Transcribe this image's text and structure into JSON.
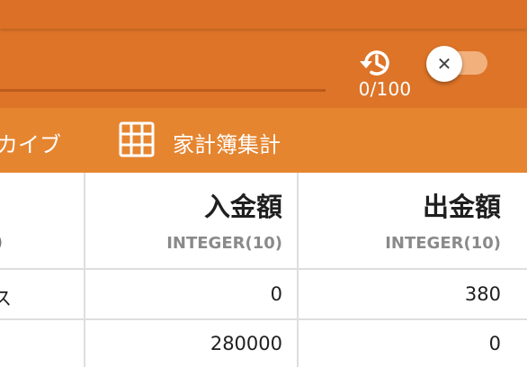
{
  "toolbar": {
    "history_icon": "history-icon",
    "history_count": "0/100",
    "toggle_icon": "close-icon",
    "toggle_symbol": "✕",
    "toggle_state": "off"
  },
  "tabs": [
    {
      "label": "カイブ",
      "icon": null
    },
    {
      "label": "家計簿集計",
      "icon": "grid-icon"
    }
  ],
  "table": {
    "columns": [
      {
        "title": "入金額",
        "type": "INTEGER(10)"
      },
      {
        "title": "出金額",
        "type": "INTEGER(10)"
      }
    ],
    "left_fragments": {
      "header_type": ")",
      "row1": "ス"
    },
    "rows": [
      [
        "0",
        "380"
      ],
      [
        "280000",
        "0"
      ]
    ]
  },
  "colors": {
    "app_bar": "#dd7428",
    "tab_bar": "#e58530",
    "grid_line": "#dedede"
  }
}
